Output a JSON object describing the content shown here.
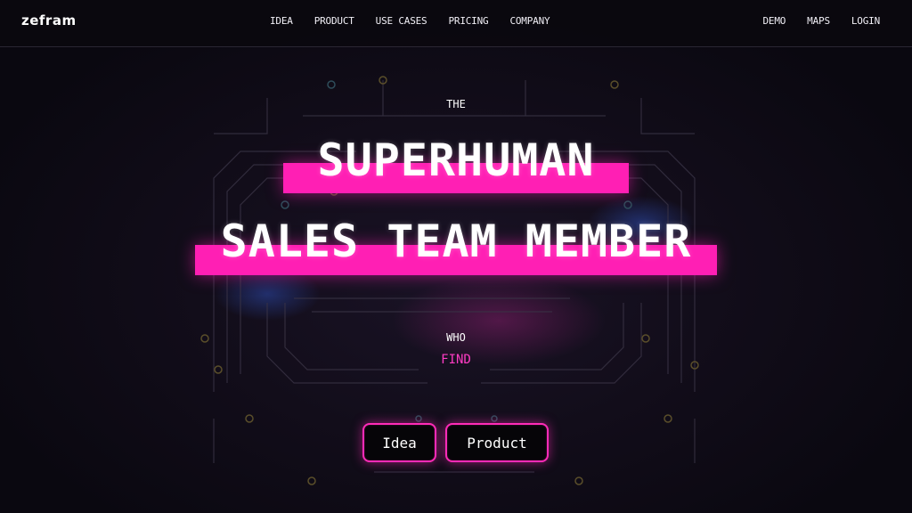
{
  "brand": {
    "logo": "zefram"
  },
  "nav": {
    "center": [
      "IDEA",
      "PRODUCT",
      "USE CASES",
      "PRICING",
      "COMPANY"
    ],
    "right": [
      "DEMO",
      "MAPS",
      "LOGIN"
    ]
  },
  "hero": {
    "eyebrow": "THE",
    "line1": "SUPERHUMAN",
    "line2": "SALES TEAM MEMBER",
    "who": "WHO",
    "find": "FIND"
  },
  "buttons": {
    "idea": "Idea",
    "product": "Product"
  },
  "colors": {
    "accent": "#ff1fb4",
    "background": "#0b0910",
    "text": "#ffffff"
  }
}
